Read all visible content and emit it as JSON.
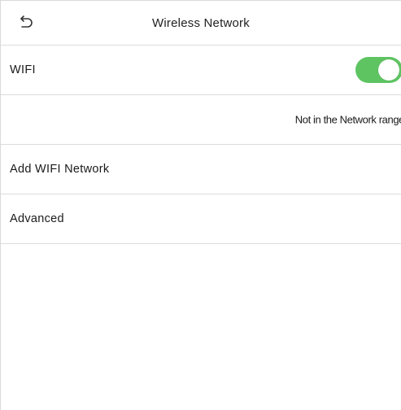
{
  "header": {
    "title": "Wireless Network",
    "back_icon": "back-arrow-icon"
  },
  "wifi": {
    "label": "WIFI",
    "enabled": true,
    "toggle_color": "#5ec462"
  },
  "status": {
    "text": "Not in the Network range"
  },
  "menu": {
    "add_wifi_label": "Add WIFI Network",
    "advanced_label": "Advanced"
  }
}
